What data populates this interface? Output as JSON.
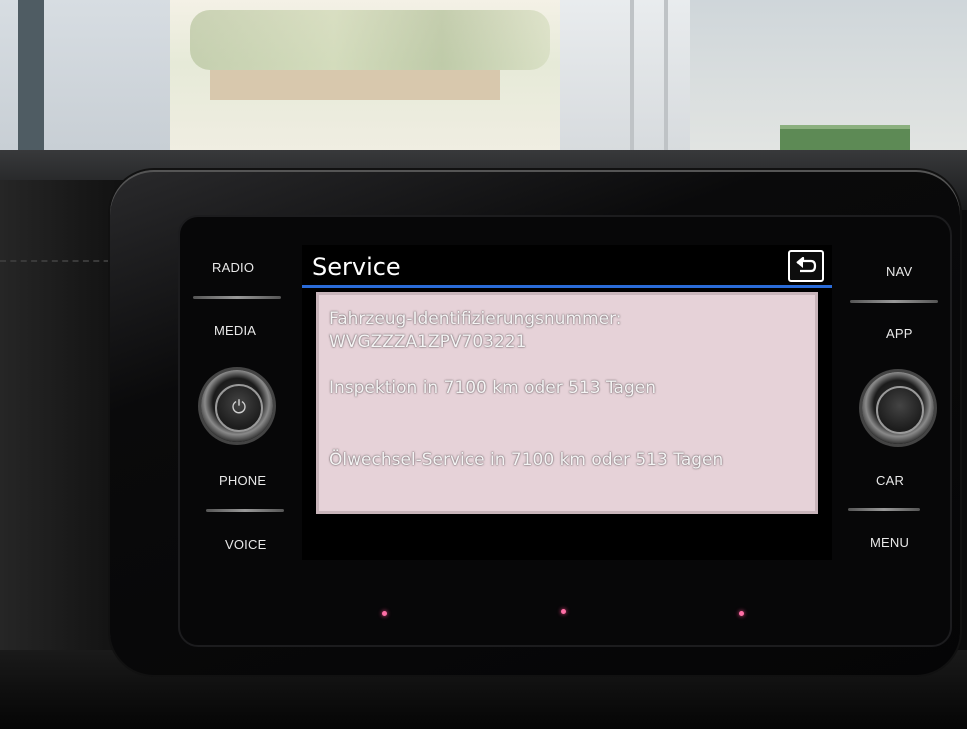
{
  "screen": {
    "title": "Service",
    "back_icon": "return-arrow-icon",
    "accent_color": "#2a6bd8",
    "lines": {
      "vin_label": "Fahrzeug-Identifizierungsnummer:",
      "vin_value": "WVGZZZA1ZPV703221",
      "inspection": "Inspektion in 7100 km oder 513 Tagen",
      "oil_service": "Ölwechsel-Service in 7100 km oder 513 Tagen"
    }
  },
  "hard_buttons": {
    "left": [
      "RADIO",
      "MEDIA",
      "PHONE",
      "VOICE"
    ],
    "right": [
      "NAV",
      "APP",
      "CAR",
      "MENU"
    ]
  },
  "knobs": {
    "left_icon": "power-icon",
    "right_icon": "rotary-knob"
  }
}
